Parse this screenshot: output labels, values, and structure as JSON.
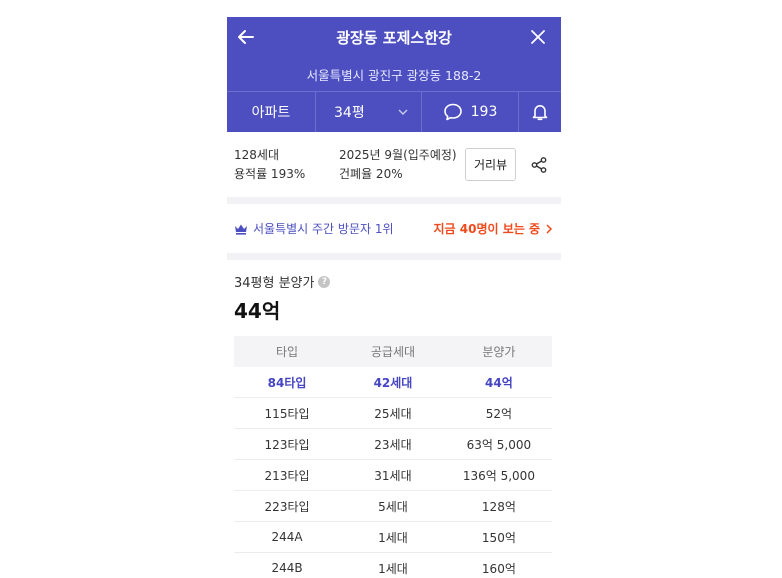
{
  "header": {
    "title": "광장동 포제스한강",
    "address": "서울특별시 광진구 광장동 188-2"
  },
  "tabs": {
    "type": "아파트",
    "size": "34평",
    "comments": "193"
  },
  "info": {
    "households": "128세대",
    "floor_area_ratio": "용적률 193%",
    "move_in": "2025년 9월(입주예정)",
    "coverage_ratio": "건폐율 20%",
    "road_view": "거리뷰"
  },
  "banner": {
    "rank": "서울특별시 주간 방문자 1위",
    "viewers": "지금 40명이 보는 중"
  },
  "price": {
    "label": "34평형 분양가",
    "value": "44억",
    "columns": [
      "타입",
      "공급세대",
      "분양가"
    ],
    "rows": [
      {
        "type": "84타입",
        "units": "42세대",
        "price": "44억",
        "selected": true
      },
      {
        "type": "115타입",
        "units": "25세대",
        "price": "52억"
      },
      {
        "type": "123타입",
        "units": "23세대",
        "price": "63억 5,000"
      },
      {
        "type": "213타입",
        "units": "31세대",
        "price": "136억 5,000"
      },
      {
        "type": "223타입",
        "units": "5세대",
        "price": "128억"
      },
      {
        "type": "244A",
        "units": "1세대",
        "price": "150억"
      },
      {
        "type": "244B",
        "units": "1세대",
        "price": "160억"
      }
    ]
  },
  "colors": {
    "brand": "#4d4fc0",
    "highlight": "#4545c4",
    "alert": "#f04a1c"
  },
  "icons": [
    "back-arrow-icon",
    "close-icon",
    "chevron-down-icon",
    "comment-icon",
    "bell-icon",
    "share-icon",
    "crown-icon",
    "chevron-right-icon",
    "help-icon"
  ]
}
